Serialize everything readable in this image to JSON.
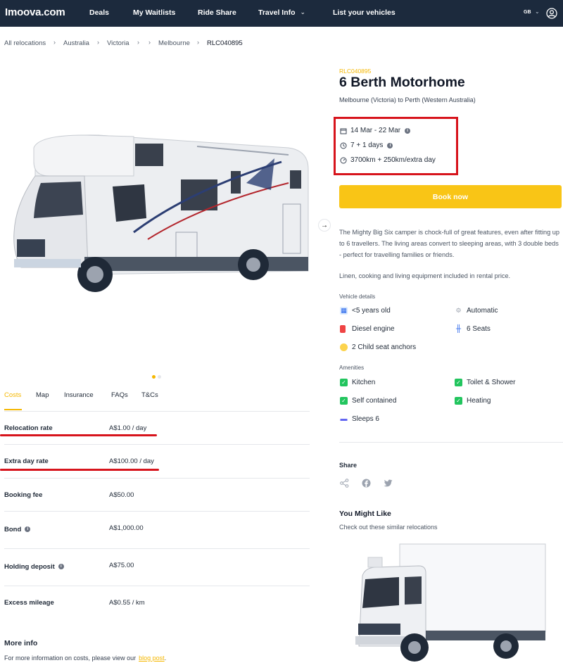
{
  "header": {
    "logo": "Imoova.com",
    "nav": [
      {
        "label": "Deals"
      },
      {
        "label": "My Waitlists"
      },
      {
        "label": "Ride Share"
      },
      {
        "label": "Travel Info"
      },
      {
        "label": "List your vehicles"
      }
    ],
    "locale": "GB"
  },
  "breadcrumb": [
    "All relocations",
    "Australia",
    "Victoria",
    "",
    "Melbourne",
    "RLC040895"
  ],
  "listing": {
    "ref": "RLC040895",
    "title": "6 Berth Motorhome",
    "route": "Melbourne (Victoria) to Perth (Western Australia)",
    "dates": "14 Mar - 22 Mar",
    "days": "7 + 1 days",
    "distance": "3700km + 250km/extra day",
    "book_label": "Book now",
    "description": "The Mighty Big Six camper is chock-full of great features, even after fitting up to 6 travellers. The living areas convert to sleeping areas, with 3 double beds - perfect for travelling families or friends.",
    "included": "Linen, cooking and living equipment included in rental price."
  },
  "vehicle_details": {
    "label": "Vehicle details",
    "items": [
      "<5 years old",
      "Automatic",
      "Diesel engine",
      "6 Seats",
      "2 Child seat anchors"
    ]
  },
  "amenities": {
    "label": "Amenities",
    "items": [
      "Kitchen",
      "Toilet & Shower",
      "Self contained",
      "Heating",
      "Sleeps 6"
    ]
  },
  "tabs": [
    "Costs",
    "Map",
    "Insurance",
    "FAQs",
    "T&Cs"
  ],
  "costs": [
    {
      "label": "Relocation rate",
      "value": "A$1.00 / day"
    },
    {
      "label": "Extra day rate",
      "value": "A$100.00 / day"
    },
    {
      "label": "Booking fee",
      "value": "A$50.00"
    },
    {
      "label": "Bond",
      "value": "A$1,000.00"
    },
    {
      "label": "Holding deposit",
      "value": "A$75.00"
    },
    {
      "label": "Excess mileage",
      "value": "A$0.55 / km"
    }
  ],
  "more_info": {
    "title": "More info",
    "text": "For more information on costs, please view our",
    "link": "blog post",
    "suffix": "."
  },
  "share": {
    "title": "Share"
  },
  "you_might_like": {
    "title": "You Might Like",
    "subtitle": "Check out these similar relocations"
  },
  "colors": {
    "accent": "#f5b700",
    "button": "#f9c516",
    "header": "#1c2a3d",
    "highlight": "#d7141c"
  }
}
